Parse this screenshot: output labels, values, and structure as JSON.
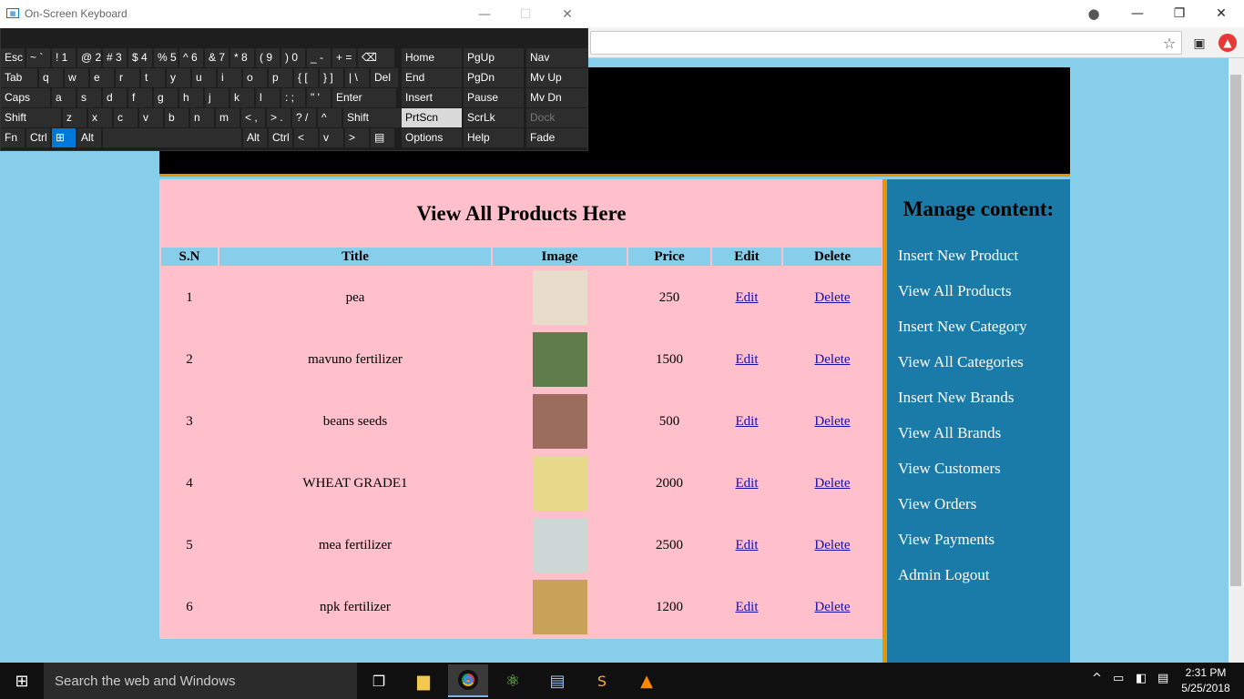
{
  "osk": {
    "title": "On-Screen Keyboard",
    "row1": [
      "Esc",
      "~ `",
      "! 1",
      "@ 2",
      "# 3",
      "$ 4",
      "% 5",
      "^ 6",
      "& 7",
      "* 8",
      "( 9",
      ") 0",
      "_ -",
      "+ =",
      "⌫"
    ],
    "row2": [
      "Tab",
      "q",
      "w",
      "e",
      "r",
      "t",
      "y",
      "u",
      "i",
      "o",
      "p",
      "{ [",
      "} ]",
      "| \\",
      "Del"
    ],
    "row3": [
      "Caps",
      "a",
      "s",
      "d",
      "f",
      "g",
      "h",
      "j",
      "k",
      "l",
      ": ;",
      "\" '",
      "Enter"
    ],
    "row4": [
      "Shift",
      "z",
      "x",
      "c",
      "v",
      "b",
      "n",
      "m",
      "< ,",
      "> .",
      "? /",
      "^",
      "Shift"
    ],
    "row5": [
      "Fn",
      "Ctrl",
      "⊞",
      "Alt",
      "",
      "Alt",
      "Ctrl",
      "<",
      "v",
      ">",
      "▤"
    ],
    "nav": [
      [
        "Home",
        "PgUp",
        "Nav"
      ],
      [
        "End",
        "PgDn",
        "Mv Up"
      ],
      [
        "Insert",
        "Pause",
        "Mv Dn"
      ],
      [
        "PrtScn",
        "ScrLk",
        "Dock"
      ],
      [
        "Options",
        "Help",
        "Fade"
      ]
    ]
  },
  "page": {
    "main_title": "View All Products Here",
    "columns": [
      "S.N",
      "Title",
      "Image",
      "Price",
      "Edit",
      "Delete"
    ],
    "products": [
      {
        "sn": "1",
        "title": "pea",
        "price": "250",
        "edit": "Edit",
        "delete": "Delete",
        "img": "#e8dccb"
      },
      {
        "sn": "2",
        "title": "mavuno fertilizer",
        "price": "1500",
        "edit": "Edit",
        "delete": "Delete",
        "img": "#5f7d4a"
      },
      {
        "sn": "3",
        "title": "beans seeds",
        "price": "500",
        "edit": "Edit",
        "delete": "Delete",
        "img": "#9a6d5e"
      },
      {
        "sn": "4",
        "title": "WHEAT GRADE1",
        "price": "2000",
        "edit": "Edit",
        "delete": "Delete",
        "img": "#e6d98a"
      },
      {
        "sn": "5",
        "title": "mea fertilizer",
        "price": "2500",
        "edit": "Edit",
        "delete": "Delete",
        "img": "#cfd6d6"
      },
      {
        "sn": "6",
        "title": "npk fertilizer",
        "price": "1200",
        "edit": "Edit",
        "delete": "Delete",
        "img": "#c9a25a"
      }
    ],
    "sidebar_title": "Manage content:",
    "sidebar_links": [
      "Insert New Product",
      "View All Products",
      "Insert New Category",
      "View All Categories",
      "Insert New Brands",
      "View All Brands",
      "View Customers",
      "View Orders",
      "View Payments",
      "Admin Logout"
    ]
  },
  "taskbar": {
    "search_placeholder": "Search the web and Windows",
    "time": "2:31 PM",
    "date": "5/25/2018"
  },
  "colors": {
    "header": "#000000",
    "accent": "#e69500",
    "main_bg": "#ffc0cb",
    "sidebar": "#1a7aa8",
    "page_bg": "#87ceeb"
  }
}
